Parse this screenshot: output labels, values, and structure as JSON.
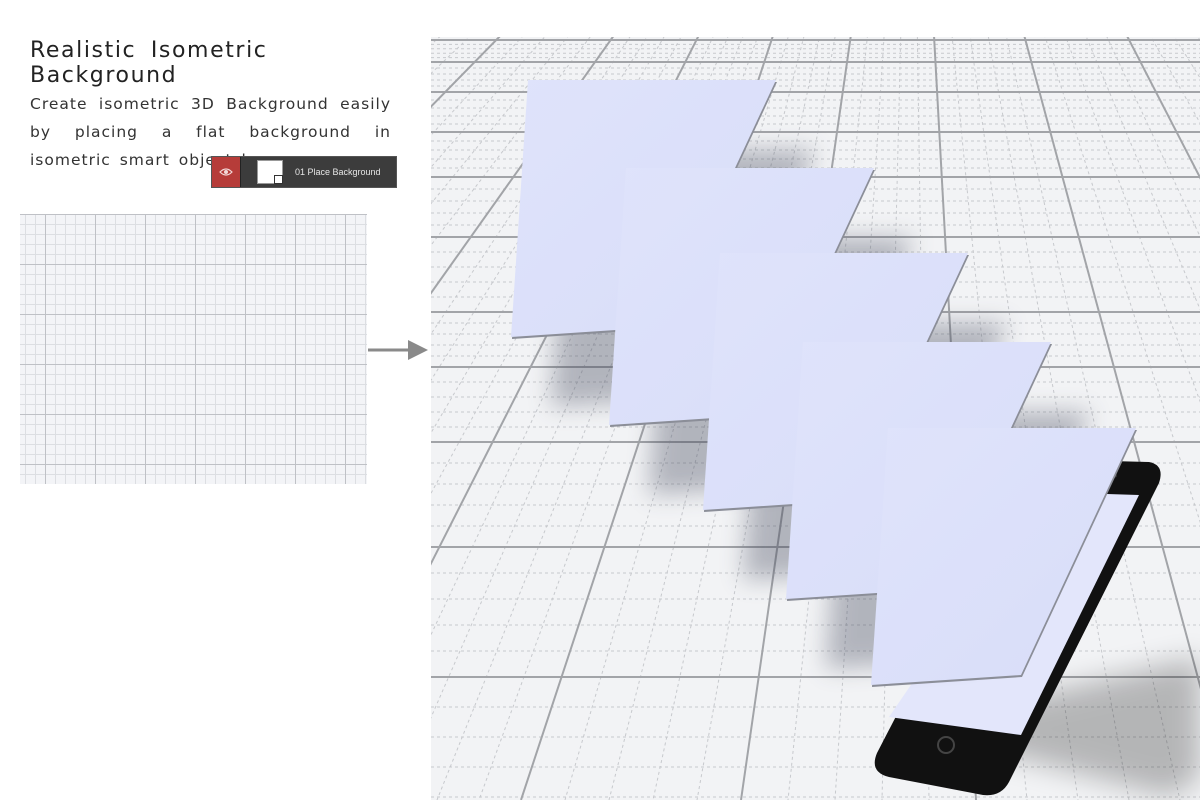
{
  "header": {
    "title": "Realistic Isometric Background",
    "description": "Create isometric 3D Background easily by placing a flat background in isometric smart object layer."
  },
  "layer": {
    "name": "01 Place Background",
    "icon_visibility": "eye-icon",
    "icon_thumbnail": "smart-object-thumbnail-icon",
    "accent_color": "#b63c39"
  },
  "colors": {
    "card_fill": "#dde2fa",
    "phone_body": "#111111",
    "grid_line": "#9a9ca0",
    "background": "#f2f3f5"
  }
}
